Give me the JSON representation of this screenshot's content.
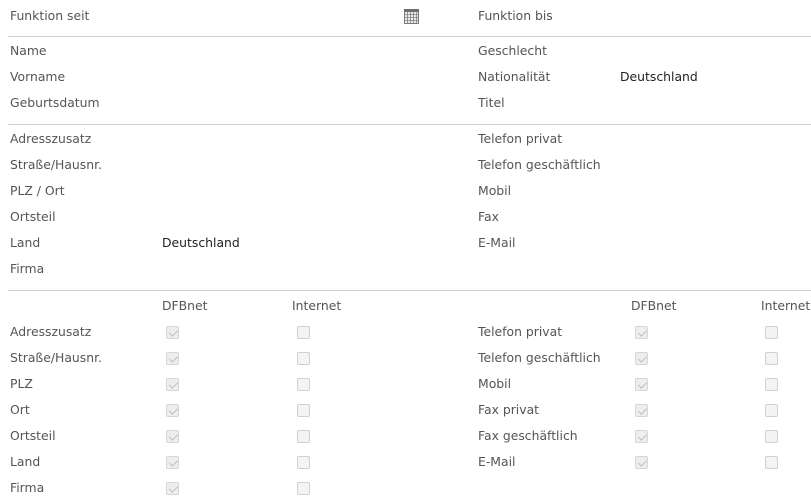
{
  "header": {
    "function_since_label": "Funktion seit",
    "function_until_label": "Funktion bis",
    "calendar_icon": "calendar-icon"
  },
  "person": {
    "name_label": "Name",
    "first_name_label": "Vorname",
    "birthdate_label": "Geburtsdatum",
    "gender_label": "Geschlecht",
    "nationality_label": "Nationalität",
    "nationality_value": "Deutschland",
    "title_label": "Titel"
  },
  "address": {
    "addition_label": "Adresszusatz",
    "street_label": "Straße/Hausnr.",
    "zip_city_label": "PLZ / Ort",
    "district_label": "Ortsteil",
    "country_label": "Land",
    "country_value": "Deutschland",
    "company_label": "Firma"
  },
  "contact": {
    "phone_private_label": "Telefon privat",
    "phone_business_label": "Telefon geschäftlich",
    "mobile_label": "Mobil",
    "fax_label": "Fax",
    "email_label": "E-Mail"
  },
  "visibility": {
    "col_dfbnet": "DFBnet",
    "col_internet": "Internet",
    "left_rows": [
      {
        "label": "Adresszusatz",
        "dfbnet": true,
        "internet": false
      },
      {
        "label": "Straße/Hausnr.",
        "dfbnet": true,
        "internet": false
      },
      {
        "label": "PLZ",
        "dfbnet": true,
        "internet": false
      },
      {
        "label": "Ort",
        "dfbnet": true,
        "internet": false
      },
      {
        "label": "Ortsteil",
        "dfbnet": true,
        "internet": false
      },
      {
        "label": "Land",
        "dfbnet": true,
        "internet": false
      },
      {
        "label": "Firma",
        "dfbnet": true,
        "internet": false
      }
    ],
    "right_rows": [
      {
        "label": "Telefon privat",
        "dfbnet": true,
        "internet": false
      },
      {
        "label": "Telefon geschäftlich",
        "dfbnet": true,
        "internet": false
      },
      {
        "label": "Mobil",
        "dfbnet": true,
        "internet": false
      },
      {
        "label": "Fax privat",
        "dfbnet": true,
        "internet": false
      },
      {
        "label": "Fax geschäftlich",
        "dfbnet": true,
        "internet": false
      },
      {
        "label": "E-Mail",
        "dfbnet": true,
        "internet": false
      }
    ]
  }
}
